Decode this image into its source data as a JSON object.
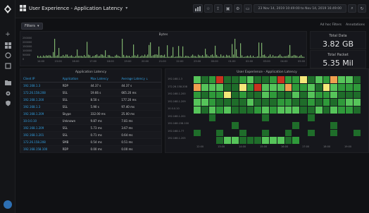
{
  "header": {
    "title": "User Experience - Application Latency",
    "caret": "▾",
    "time_range": "23 Nov 14, 2019 10:49:00 to Nov 14, 2019 16:49:00"
  },
  "filter": {
    "label": "Filters",
    "caret": "▾"
  },
  "filter_links": [
    "Ad hoc Filters",
    "Annotations"
  ],
  "bytes_panel": {
    "title": "Bytes",
    "y_ticks": [
      "250000",
      "200000",
      "150000",
      "100000",
      "50000",
      "0"
    ],
    "x_ticks": [
      "14:00",
      "15:00",
      "16:00",
      "17:00",
      "18:00",
      "19:00",
      "20:00",
      "21:00",
      "22:00",
      "23:00",
      "00:00",
      "01:00",
      "02:00",
      "03:00",
      "04:00",
      "05:00"
    ]
  },
  "stats": [
    {
      "title": "Total Data",
      "value": "3.82 GB"
    },
    {
      "title": "Total Packet",
      "value": "5.35 Mil"
    }
  ],
  "latency_table": {
    "title": "Application Latency",
    "headers": [
      "Client IP",
      "Application",
      "Max Latency",
      "Average Latency ↓"
    ],
    "rows": [
      [
        "192.168.1.3",
        "RDP",
        "44.37 s",
        "44.37 s"
      ],
      [
        "172.26.158.208",
        "SSL",
        "19.66 s",
        "665.20 ms"
      ],
      [
        "192.168.1.200",
        "SSL",
        "8.50 s",
        "177.20 ms"
      ],
      [
        "192.168.1.3",
        "SSL",
        "5.90 s",
        "97.40 ms"
      ],
      [
        "192.168.1.209",
        "Skype",
        "332.00 ms",
        "25.00 ms"
      ],
      [
        "10.0.0.10",
        "Unknown",
        "9.87 ms",
        "7.81 ms"
      ],
      [
        "192.168.1.209",
        "SSL",
        "5.73 ms",
        "3.67 ms"
      ],
      [
        "192.168.1.201",
        "SSL",
        "0.71 ms",
        "0.64 ms"
      ],
      [
        "172.26.158.208",
        "SMB",
        "0.54 ms",
        "0.51 ms"
      ],
      [
        "192.168.158.100",
        "RDP",
        "0.00 ms",
        "0.00 ms"
      ]
    ]
  },
  "heatmap_panel": {
    "title": "User Experience - Application Latency",
    "y_labels": [
      "192.168.1.3",
      "172.26.158.208",
      "192.168.1.200",
      "192.168.1.209",
      "10.0.0.10",
      "192.168.1.201",
      "192.168.158.100",
      "192.168.1.77",
      "192.168.1.205"
    ],
    "x_ticks": [
      "12:00",
      "13:00",
      "14:00",
      "15:00",
      "16:00",
      "17:00",
      "18:00",
      "19:00"
    ]
  },
  "colors": {
    "accent": "#33a2e5",
    "heat_dark": "#1f6d2a",
    "heat_mid": "#2f9a3a",
    "heat_bright": "#56c45a",
    "heat_yellow": "#f5e87a",
    "heat_orange": "#f0a050",
    "heat_red": "#c8321f"
  },
  "sidebar_icons": [
    "plus-icon",
    "dashboards-icon",
    "explore-icon",
    "alerting-icon",
    "config-icon",
    "admin-icon",
    "shield-icon"
  ]
}
